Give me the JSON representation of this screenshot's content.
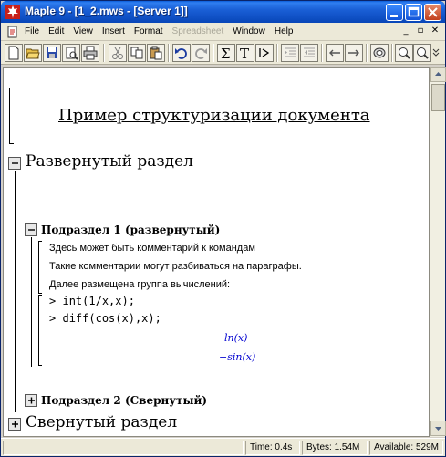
{
  "window": {
    "title": "Maple 9  - [1_2.mws - [Server 1]]"
  },
  "menu": {
    "items": [
      {
        "label": "File",
        "enabled": true
      },
      {
        "label": "Edit",
        "enabled": true
      },
      {
        "label": "View",
        "enabled": true
      },
      {
        "label": "Insert",
        "enabled": true
      },
      {
        "label": "Format",
        "enabled": true
      },
      {
        "label": "Spreadsheet",
        "enabled": false
      },
      {
        "label": "Window",
        "enabled": true
      },
      {
        "label": "Help",
        "enabled": true
      }
    ]
  },
  "toolbar": {
    "icons": [
      "new-icon",
      "open-icon",
      "save-icon",
      "print-icon",
      "cut-icon",
      "copy-icon",
      "paste-icon",
      "undo-icon",
      "redo-icon",
      "sigma-icon",
      "text-icon",
      "prompt-icon",
      "indent-icon",
      "outdent-icon",
      "back-arrow-icon",
      "forward-arrow-icon",
      "stop-icon",
      "zoom-in-icon",
      "zoom-out-icon"
    ]
  },
  "document": {
    "title": "Пример структуризации документа",
    "section1": {
      "title": "Развернутый раздел",
      "expanded": true,
      "subsection1": {
        "title": "Подраздел 1 (развернутый)",
        "expanded": true,
        "comments": [
          "Здесь может быть комментарий к командам",
          "Такие комментарии могут разбиваться на параграфы.",
          "Далее размещена группа вычислений:"
        ],
        "commands": [
          {
            "prompt": ">",
            "text": "int(1/x,x);"
          },
          {
            "prompt": ">",
            "text": "diff(cos(x),x);"
          }
        ],
        "outputs": [
          "ln(x)",
          "−sin(x)"
        ]
      },
      "subsection2": {
        "title": "Подраздел 2 (Свернутый)",
        "expanded": false
      }
    },
    "section2": {
      "title": "Свернутый раздел",
      "expanded": false
    }
  },
  "status": {
    "time": "Time:  0.4s",
    "bytes": "Bytes: 1.54M",
    "available": "Available: 529M"
  }
}
